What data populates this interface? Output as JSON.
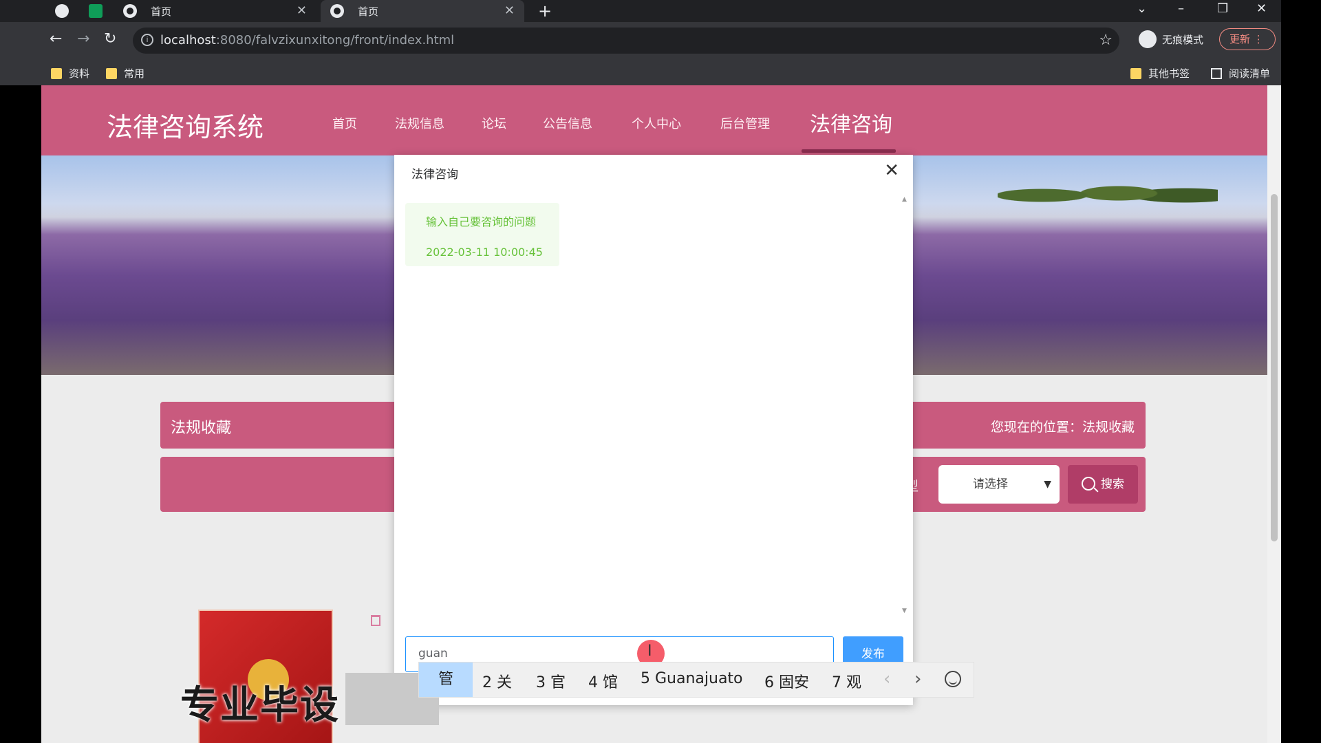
{
  "browser": {
    "tabs": [
      {
        "title": "首页",
        "active": false
      },
      {
        "title": "首页",
        "active": true
      }
    ],
    "url_host": "localhost",
    "url_path": ":8080/falvzixunxitong/front/index.html",
    "incognito_label": "无痕模式",
    "update_label": "更新",
    "bookmarks": [
      "资料",
      "常用"
    ],
    "other_bookmarks": "其他书签",
    "reading_list": "阅读清单"
  },
  "site": {
    "logo": "法律咨询系统",
    "nav": [
      "首页",
      "法规信息",
      "论坛",
      "公告信息",
      "个人中心",
      "后台管理",
      "法律咨询"
    ],
    "active_nav": "法律咨询"
  },
  "page": {
    "section_title": "法规收藏",
    "breadcrumb": "您现在的位置：法规收藏",
    "type_label_fragment": "型",
    "select_placeholder": "请选择",
    "search_label": "搜索"
  },
  "modal": {
    "title": "法律咨询",
    "messages": [
      {
        "text": "输入自己要咨询的问题",
        "time": "2022-03-11 10:00:45"
      }
    ],
    "input_value": "guan",
    "publish_label": "发布"
  },
  "ime": {
    "candidates": [
      "管",
      "2 关",
      "3 官",
      "4 馆",
      "5 Guanajuato",
      "6 固安",
      "7 观"
    ]
  },
  "watermark": "专业毕设",
  "colors": {
    "header": "#c95a7e",
    "primary_button": "#409eff",
    "message_text": "#67c23a"
  }
}
